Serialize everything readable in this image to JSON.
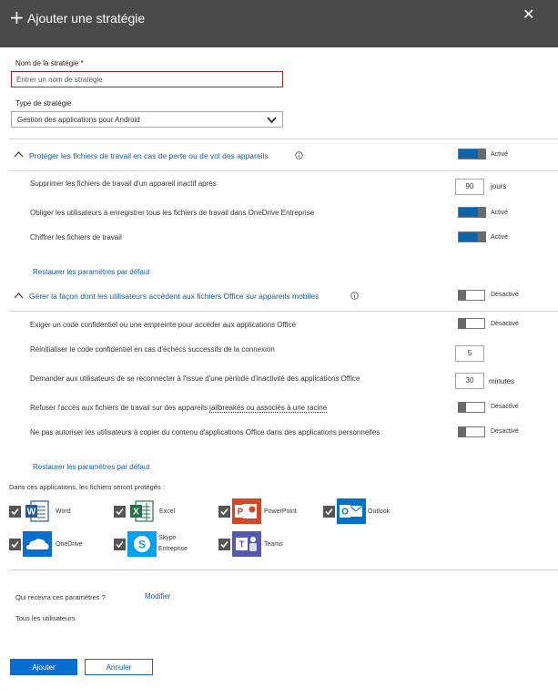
{
  "header": {
    "title": "Ajouter une stratégie",
    "plus_icon": "+",
    "close_icon": "✕"
  },
  "form": {
    "name_label": "Nom de la stratégie *",
    "name_placeholder": "Entrer un nom de stratégie",
    "type_label": "Type de stratégie",
    "type_value": "Gestion des applications pour Android"
  },
  "section1": {
    "title": "Protéger les fichiers de travail en cas de perte ou de vol des appareils",
    "toggle_state": "Activé",
    "rows": [
      {
        "label": "Supprimer les fichiers de travail d'un appareil inactif après",
        "value": "90",
        "unit": "jours"
      },
      {
        "label": "Obliger les utilisateurs à enregistrer tous les fichiers de travail dans OneDrive Entreprise",
        "state": "Activé"
      },
      {
        "label": "Chiffrer les fichiers de travail",
        "state": "Activé"
      }
    ],
    "restore_link": "Restaurer les paramètres par défaut"
  },
  "section2": {
    "title": "Gérer la façon dont les utilisateurs accèdent aux fichiers Office sur appareils mobiles",
    "toggle_state": "Désactivé",
    "rows": [
      {
        "label": "Exiger un code confidentiel ou une empreinte pour accéder aux applications Office",
        "state": "Désactivé"
      },
      {
        "label": "Réinitialiser le code confidentiel en cas d'échecs successifs de la connexion",
        "value": "5"
      },
      {
        "label": "Demander aux utilisateurs de se reconnecter à l'issue d'une période d'inactivité des applications Office",
        "value": "30",
        "unit": "minutes"
      },
      {
        "label_prefix": "Refuser l'accès aux fichiers de travail sur des appareils ",
        "label_link": "jailbreakés ou associés à une racine",
        "state": "Désactivé"
      },
      {
        "label": "Ne pas autoriser les utilisateurs à copier du contenu d'applications Office dans des applications personnelles",
        "state": "Désactivé"
      }
    ],
    "restore_link": "Restaurer les paramètres par défaut"
  },
  "apps": {
    "title": "Dans ces applications, les fichiers seront protégés :",
    "items": [
      {
        "name": "Word",
        "color": "#2b579a",
        "letter": "W"
      },
      {
        "name": "Excel",
        "color": "#217346",
        "letter": "X"
      },
      {
        "name": "PowerPoint",
        "color": "#d24726",
        "letter": "P"
      },
      {
        "name": "Outlook",
        "color": "#0072c6",
        "letter": "O"
      },
      {
        "name": "OneDrive",
        "color": "#0a6ed1"
      },
      {
        "name_line1": "Skype",
        "name_line2": "Entreprise",
        "color": "#00a2ed",
        "letter": "S"
      },
      {
        "name": "Teams",
        "color": "#5558af",
        "letter": "T"
      }
    ]
  },
  "recipients": {
    "question": "Qui recevra ces paramètres ?",
    "modify_link": "Modifier",
    "value": "Tous les utilisateurs"
  },
  "footer": {
    "add_button": "Ajouter",
    "cancel_button": "Annuler"
  },
  "colors": {
    "header_bg": "#4a4a4a",
    "accent": "#0a6ed1",
    "toggle_on": "#0f64a8",
    "error_border": "#a4262c"
  }
}
